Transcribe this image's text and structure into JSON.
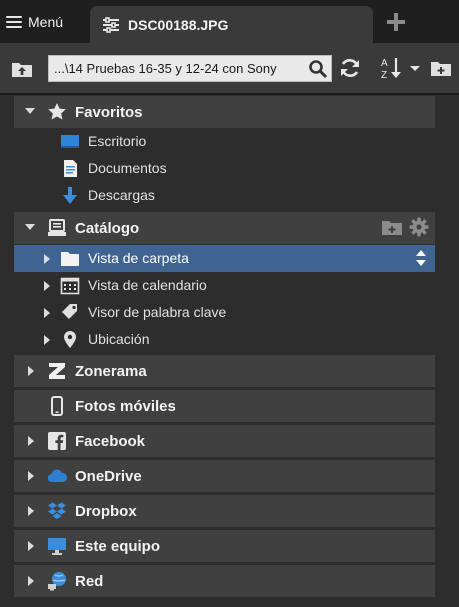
{
  "tabbar": {
    "menu_label": "Menú",
    "tab_label": "DSC00188.JPG",
    "new_tab_icon": "plus-icon"
  },
  "toolbar": {
    "path": "...\\14 Pruebas 16-35 y 12-24 con Sony",
    "icons": [
      "up-folder-icon",
      "search-icon",
      "refresh-icon",
      "sort-icon",
      "new-folder-icon"
    ]
  },
  "sections": {
    "favoritos": {
      "title": "Favoritos",
      "items": [
        {
          "label": "Escritorio",
          "icon": "desktop-icon"
        },
        {
          "label": "Documentos",
          "icon": "document-icon"
        },
        {
          "label": "Descargas",
          "icon": "download-arrow-icon"
        }
      ]
    },
    "catalogo": {
      "title": "Catálogo",
      "items": [
        {
          "label": "Vista de carpeta",
          "icon": "folder-icon",
          "selected": true
        },
        {
          "label": "Vista de calendario",
          "icon": "calendar-icon"
        },
        {
          "label": "Visor de palabra clave",
          "icon": "tag-icon"
        },
        {
          "label": "Ubicación",
          "icon": "location-pin-icon"
        }
      ]
    },
    "zonerama": {
      "title": "Zonerama"
    },
    "fotos_moviles": {
      "title": "Fotos móviles"
    },
    "facebook": {
      "title": "Facebook"
    },
    "onedrive": {
      "title": "OneDrive"
    },
    "dropbox": {
      "title": "Dropbox"
    },
    "este_equipo": {
      "title": "Este equipo"
    },
    "red": {
      "title": "Red"
    }
  },
  "colors": {
    "selected_row": "#3f6491",
    "section_header": "#404040",
    "accent_blue": "#3b8ede"
  }
}
